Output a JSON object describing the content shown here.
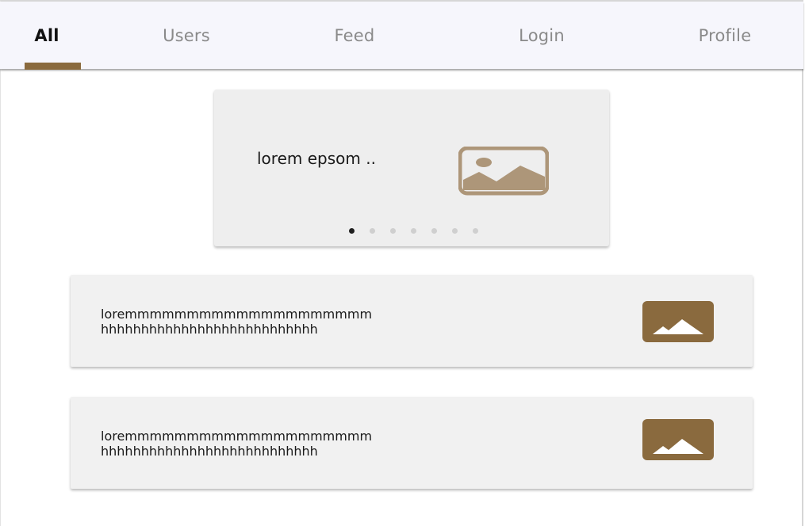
{
  "tabs": [
    {
      "label": "All",
      "active": true
    },
    {
      "label": "Users",
      "active": false
    },
    {
      "label": "Feed",
      "active": false
    },
    {
      "label": "Login",
      "active": false
    },
    {
      "label": "Profile",
      "active": false
    }
  ],
  "colors": {
    "accent": "#8a6a3e",
    "tabbar_bg": "#f6f6fc",
    "carousel_image": "#ad9679",
    "card_image": "#8a6a3e"
  },
  "carousel": {
    "caption": "lorem epsom ..",
    "image_icon": "image-icon",
    "slide_count": 7,
    "active_slide": 1
  },
  "cards": [
    {
      "line1": "loremmmmmmmmmmmmmmmmmmmm",
      "line2": "hhhhhhhhhhhhhhhhhhhhhhhhhhh",
      "image_icon": "image-icon"
    },
    {
      "line1": "loremmmmmmmmmmmmmmmmmmmm",
      "line2": "hhhhhhhhhhhhhhhhhhhhhhhhhhh",
      "image_icon": "image-icon"
    }
  ]
}
